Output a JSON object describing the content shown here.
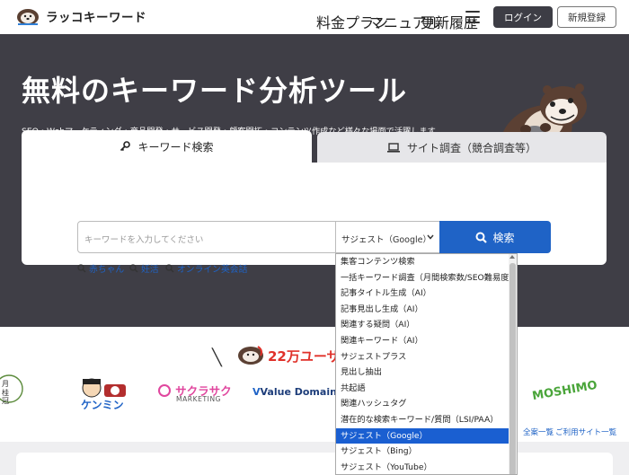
{
  "header": {
    "logo_text": "ラッコキーワード",
    "nav": [
      "料金プラン",
      "マニュアル",
      "更新履歴"
    ],
    "login": "ログイン",
    "register": "新規登録"
  },
  "hero": {
    "title": "無料のキーワード分析ツール",
    "subtitle": "SEO・Webマーケティング・商品開発・サービス開発・顧客開拓・コンテンツ作成など様々な場面で活躍します"
  },
  "tabs": {
    "keyword": "キーワード検索",
    "site": "サイト調査（競合調査等）"
  },
  "search": {
    "placeholder": "キーワードを入力してください",
    "selected": "サジェスト（Google）",
    "button": "検索"
  },
  "suggestions": [
    "赤ちゃん",
    "妊活",
    "オンライン英会話"
  ],
  "dropdown_options": [
    "集客コンテンツ検索",
    "一括キーワード調査（月間検索数/SEO難易度）",
    "記事タイトル生成（AI）",
    "記事見出し生成（AI）",
    "関連する疑問（AI）",
    "関連キーワード（AI）",
    "サジェストプラス",
    "見出し抽出",
    "共起語",
    "関連ハッシュタグ",
    "潜在的な検索キーワード/質問（LSI/PAA）",
    "サジェスト（Google）",
    "サジェスト（Bing）",
    "サジェスト（YouTube）"
  ],
  "dropdown_selected_index": 11,
  "users": {
    "text": "22万ユーザ"
  },
  "brands": {
    "kenmin": "ケンミン",
    "sakurasaku_1": "サクラサク",
    "sakurasaku_2": "MARKETING",
    "valuedomain": "Value Domain",
    "moshimo": "MOSHIMO"
  },
  "links": [
    "全案一覧",
    "ご利用サイト一覧"
  ],
  "colors": {
    "hero_bg": "#3f3e46",
    "accent_blue": "#1f63c6",
    "selected_blue": "#1a5fd1",
    "red": "#e0312a"
  }
}
